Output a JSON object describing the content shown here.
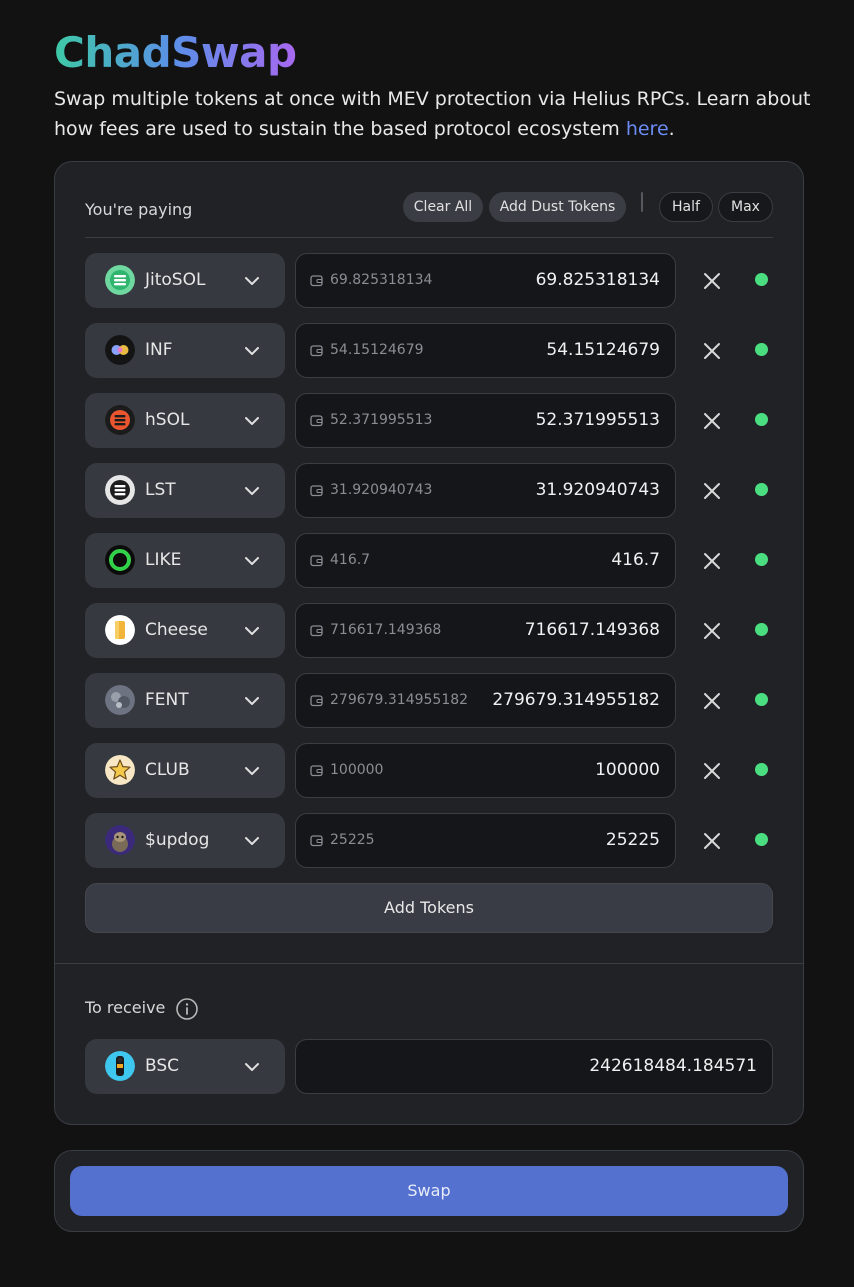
{
  "header": {
    "title": "ChadSwap",
    "subtitle_text": "Swap multiple tokens at once with MEV protection via Helius RPCs. Learn about how fees are used to sustain the based protocol ecosystem ",
    "subtitle_link": "here",
    "subtitle_end": "."
  },
  "paying": {
    "label": "You're paying",
    "clear_all": "Clear All",
    "add_dust": "Add Dust Tokens",
    "half": "Half",
    "max": "Max",
    "tokens": [
      {
        "symbol": "JitoSOL",
        "icon": "jitosol-icon",
        "balance": "69.825318134",
        "amount": "69.825318134"
      },
      {
        "symbol": "INF",
        "icon": "inf-icon",
        "balance": "54.15124679",
        "amount": "54.15124679"
      },
      {
        "symbol": "hSOL",
        "icon": "hsol-icon",
        "balance": "52.371995513",
        "amount": "52.371995513"
      },
      {
        "symbol": "LST",
        "icon": "lst-icon",
        "balance": "31.920940743",
        "amount": "31.920940743"
      },
      {
        "symbol": "LIKE",
        "icon": "like-icon",
        "balance": "416.7",
        "amount": "416.7"
      },
      {
        "symbol": "Cheese",
        "icon": "cheese-icon",
        "balance": "716617.149368",
        "amount": "716617.149368"
      },
      {
        "symbol": "FENT",
        "icon": "fent-icon",
        "balance": "279679.314955182",
        "amount": "279679.314955182"
      },
      {
        "symbol": "CLUB",
        "icon": "club-icon",
        "balance": "100000",
        "amount": "100000"
      },
      {
        "symbol": "$updog",
        "icon": "updog-icon",
        "balance": "25225",
        "amount": "25225"
      }
    ],
    "add_tokens": "Add Tokens",
    "status_color": "#4ade80"
  },
  "receive": {
    "label": "To receive",
    "symbol": "BSC",
    "icon": "bsc-icon",
    "amount": "242618484.184571"
  },
  "swap": {
    "label": "Swap",
    "color": "#5471cf"
  }
}
